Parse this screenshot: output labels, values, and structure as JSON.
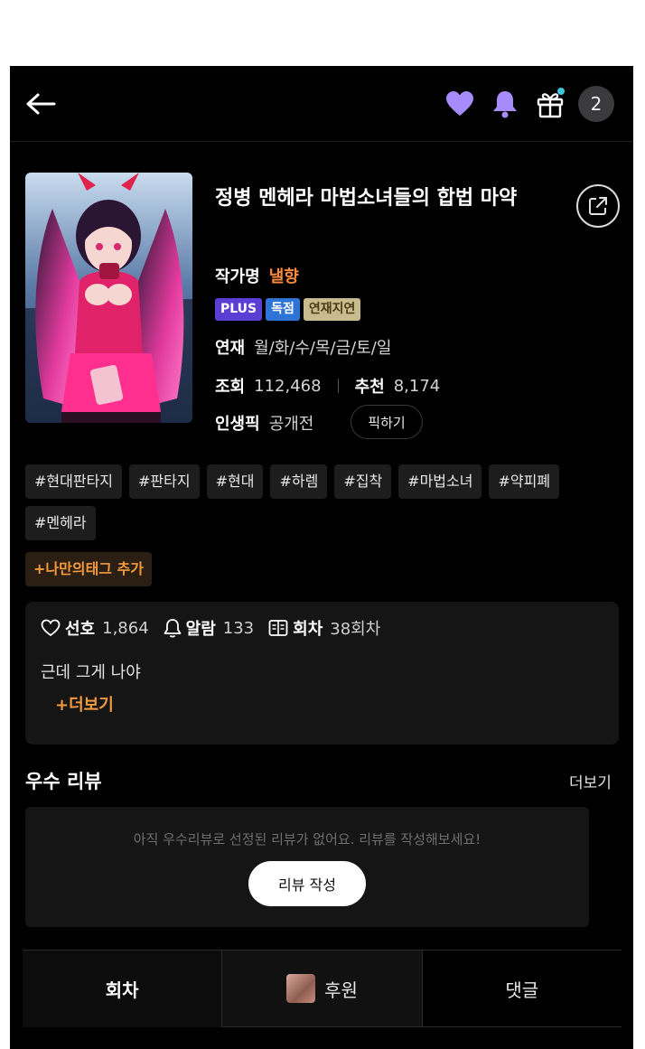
{
  "header": {
    "notification_count": "2",
    "accent_color": "#a78bfa"
  },
  "book": {
    "title": "정병 멘헤라 마법소녀들의 합법 마약",
    "author_label": "작가명",
    "author": "낼향",
    "badges": [
      "PLUS",
      "독점",
      "연재지연"
    ],
    "schedule_label": "연재",
    "schedule": "월/화/수/목/금/토/일",
    "views_label": "조회",
    "views": "112,468",
    "recommend_label": "추천",
    "recommend": "8,174",
    "life_pick_label": "인생픽",
    "life_pick_status": "공개전",
    "pick_button": "픽하기"
  },
  "tags": [
    "#현대판타지",
    "#판타지",
    "#현대",
    "#하렘",
    "#집착",
    "#마법소녀",
    "#약피폐",
    "#멘헤라"
  ],
  "add_tag": "+나만의태그 추가",
  "stats": {
    "favorite_label": "선호",
    "favorite_value": "1,864",
    "alarm_label": "알람",
    "alarm_value": "133",
    "episode_label": "회차",
    "episode_value": "38회차",
    "description": "근데 그게 나야",
    "more": "+더보기"
  },
  "review": {
    "title": "우수 리뷰",
    "more": "더보기",
    "empty_message": "아직 우수리뷰로 선정된 리뷰가 없어요. 리뷰를 작성해보세요!",
    "write_button": "리뷰 작성"
  },
  "tabs": [
    "회차",
    "후원",
    "댓글"
  ]
}
